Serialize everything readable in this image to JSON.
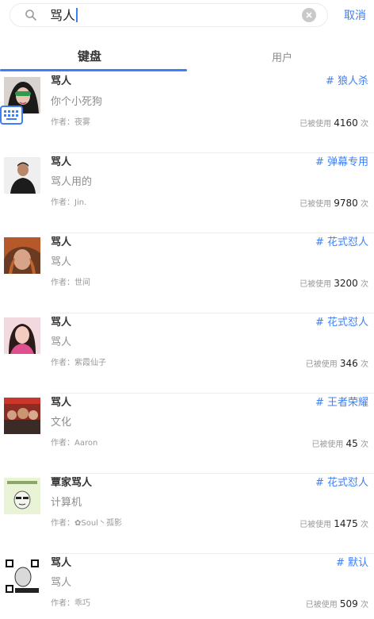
{
  "search": {
    "query": "骂人",
    "cancel_label": "取消"
  },
  "tabs": [
    {
      "label": "键盘",
      "active": true
    },
    {
      "label": "用户",
      "active": false
    }
  ],
  "colors": {
    "accent": "#3d7ff5"
  },
  "items": [
    {
      "title": "骂人",
      "content": "你个小死狗",
      "author": "作者：夜雾",
      "tag": "# 狼人杀",
      "usage_prefix": "已被使用",
      "usage_count": "4160",
      "usage_suffix": "次"
    },
    {
      "title": "骂人",
      "content": "骂人用的",
      "author": "作者：Jin.",
      "tag": "# 弹幕专用",
      "usage_prefix": "已被使用",
      "usage_count": "9780",
      "usage_suffix": "次"
    },
    {
      "title": "骂人",
      "content": "骂人",
      "author": "作者：世间",
      "tag": "# 花式怼人",
      "usage_prefix": "已被使用",
      "usage_count": "3200",
      "usage_suffix": "次"
    },
    {
      "title": "骂人",
      "content": "骂人",
      "author": "作者：紫霞仙子",
      "tag": "# 花式怼人",
      "usage_prefix": "已被使用",
      "usage_count": "346",
      "usage_suffix": "次"
    },
    {
      "title": "骂人",
      "content": "文化",
      "author": "作者：Aaron",
      "tag": "# 王者荣耀",
      "usage_prefix": "已被使用",
      "usage_count": "45",
      "usage_suffix": "次"
    },
    {
      "title": "覃家骂人",
      "content": "计算机",
      "author": "作者：✿Soul丶孤影",
      "tag": "# 花式怼人",
      "usage_prefix": "已被使用",
      "usage_count": "1475",
      "usage_suffix": "次"
    },
    {
      "title": "骂人",
      "content": "骂人",
      "author": "作者：乖巧",
      "tag": "# 默认",
      "usage_prefix": "已被使用",
      "usage_count": "509",
      "usage_suffix": "次"
    }
  ]
}
